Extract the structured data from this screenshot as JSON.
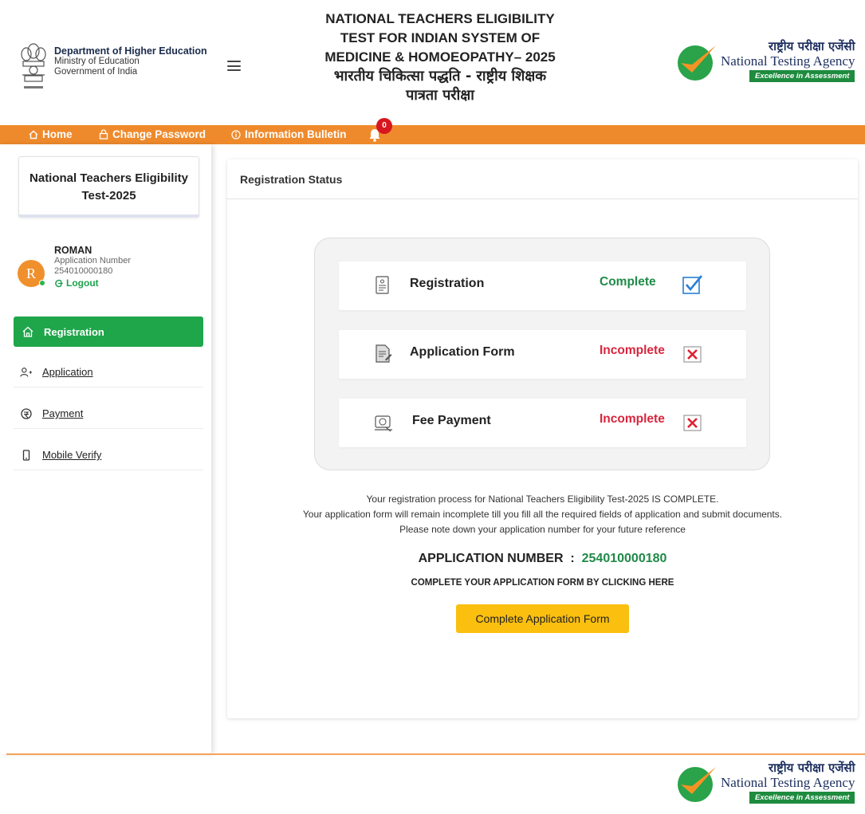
{
  "header": {
    "dept_line1": "Department of Higher Education",
    "dept_line2": "Ministry of Education",
    "dept_line3": "Government of India",
    "title_en_1": "NATIONAL TEACHERS ELIGIBILITY",
    "title_en_2": "TEST FOR INDIAN SYSTEM OF",
    "title_en_3": "MEDICINE & HOMOEOPATHY– 2025",
    "title_hi_1": "भारतीय चिकित्सा पद्धति - राष्ट्रीय शिक्षक",
    "title_hi_2": "पात्रता परीक्षा"
  },
  "nta_logo": {
    "hindi": "राष्ट्रीय परीक्षा एजेंसी",
    "english": "National Testing Agency",
    "tagline": "Excellence in Assessment"
  },
  "navbar": {
    "home": "Home",
    "change_password": "Change Password",
    "information_bulletin": "Information Bulletin",
    "notification_count": "0"
  },
  "sidebar": {
    "exam_title_1": "National Teachers Eligibility",
    "exam_title_2": "Test-2025",
    "user_name": "ROMAN",
    "user_initial": "R",
    "app_number_label": "Application Number",
    "app_number": "254010000180",
    "logout": "Logout",
    "menu": [
      {
        "label": "Registration",
        "icon": "home-icon"
      },
      {
        "label": "Application",
        "icon": "add-user-icon"
      },
      {
        "label": "Payment",
        "icon": "payment-icon"
      },
      {
        "label": "Mobile Verify",
        "icon": "mobile-icon"
      }
    ]
  },
  "main": {
    "panel_title": "Registration Status",
    "rows": [
      {
        "label": "Registration",
        "status": "Complete"
      },
      {
        "label": "Application Form",
        "status": "Incomplete"
      },
      {
        "label": "Fee Payment",
        "status": "Incomplete"
      }
    ],
    "info_1": "Your registration process for National Teachers Eligibility Test-2025 IS COMPLETE.",
    "info_2": "Your application form will remain incomplete till you fill all the required fields of application and submit documents.",
    "info_3": "Please note down your application number for your future reference",
    "app_number_label": "APPLICATION NUMBER",
    "app_number_sep": ":",
    "app_number": "254010000180",
    "click_here": "COMPLETE YOUR APPLICATION FORM BY CLICKING HERE",
    "button_label": "Complete Application Form"
  },
  "colors": {
    "nav_orange": "#ef8a2c",
    "green": "#1fa64a",
    "complete_green": "#1f8a47",
    "incomplete_red": "#d7263d",
    "button_yellow": "#fbbf0f",
    "nta_navy": "#1d2f5f"
  }
}
